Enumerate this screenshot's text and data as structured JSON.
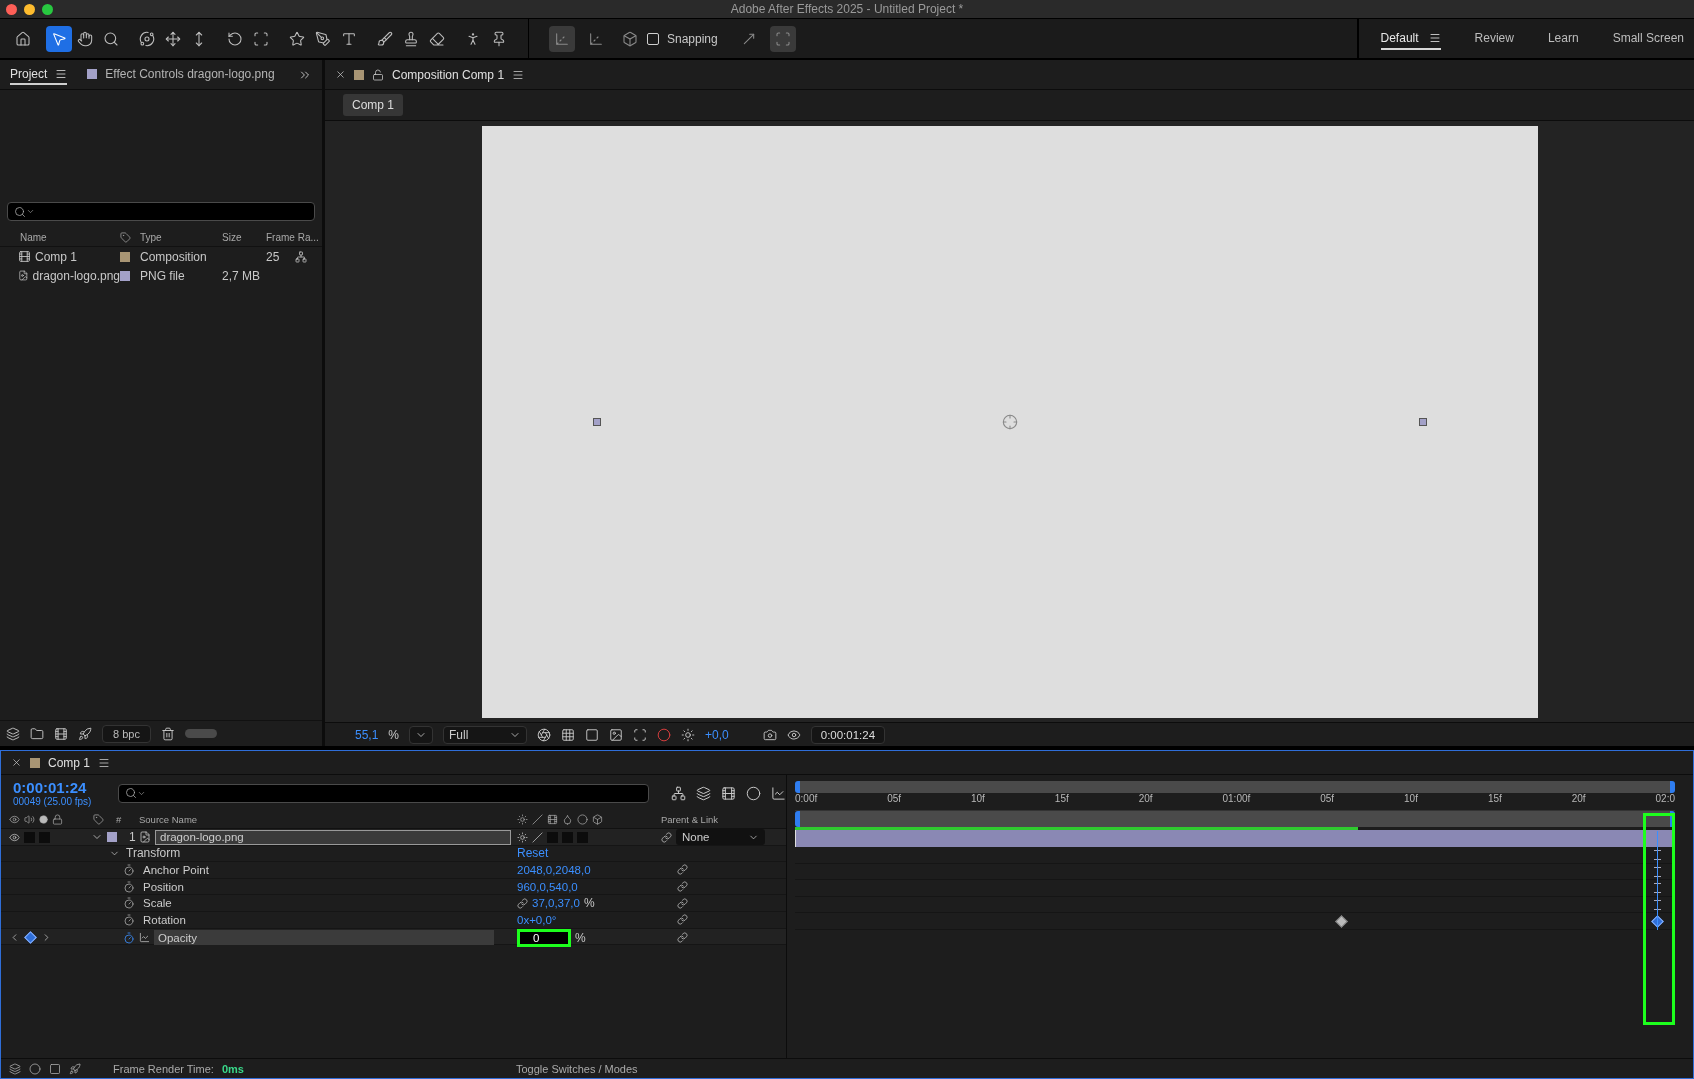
{
  "window": {
    "title": "Adobe After Effects 2025 - Untitled Project *"
  },
  "toolbar": {
    "tools": [
      {
        "selected": false
      },
      {
        "selected": true
      },
      {
        "selected": false
      },
      {
        "selected": false
      },
      {
        "selected": false
      },
      {
        "selected": false
      },
      {
        "selected": false
      },
      {
        "selected": false
      },
      {
        "selected": false
      },
      {
        "selected": false
      },
      {
        "selected": false
      },
      {
        "selected": false
      },
      {
        "selected": false
      },
      {
        "selected": false
      },
      {
        "selected": false
      },
      {
        "selected": false
      },
      {
        "selected": false
      }
    ],
    "snapping": {
      "label": "Snapping",
      "checked": false
    },
    "snap_options": [
      {
        "on": false
      },
      {
        "on": true
      }
    ],
    "workspaces": [
      {
        "label": "Default",
        "selected": true
      },
      {
        "label": "Review",
        "selected": false
      },
      {
        "label": "Learn",
        "selected": false
      },
      {
        "label": "Small Screen",
        "selected": false
      }
    ]
  },
  "project_panel": {
    "tabs": [
      {
        "label": "Project",
        "selected": true
      },
      {
        "label": "Effect Controls dragon-logo.png",
        "selected": false,
        "color": "#a3a1c8"
      }
    ],
    "columns": [
      "Name",
      "Type",
      "Size",
      "Frame Ra..."
    ],
    "rows": [
      {
        "name": "Comp 1",
        "kind": "composition",
        "color": "#a89574",
        "type": "Composition",
        "size": "",
        "frame_rate": "25"
      },
      {
        "name": "dragon-logo.png",
        "kind": "file",
        "color": "#a3a1c8",
        "type": "PNG file",
        "size": "2,7 MB",
        "frame_rate": ""
      }
    ],
    "bit_depth": "8 bpc"
  },
  "composition_panel": {
    "tab": "Composition Comp 1",
    "color": "#a89574",
    "breadcrumb": "Comp 1",
    "zoom": "55,1",
    "zoom_unit": "%",
    "resolution": "Full",
    "exposure": "+0,0",
    "timecode": "0:00:01:24"
  },
  "timeline": {
    "tab": "Comp 1",
    "color": "#a89574",
    "timecode": "0:00:01:24",
    "frame_info": "00049 (25.00 fps)",
    "columns": {
      "number": "#",
      "source": "Source Name",
      "parent": "Parent & Link"
    },
    "layer": {
      "index": "1",
      "name": "dragon-logo.png",
      "color": "#a3a1c8",
      "parent": "None",
      "expanded": true
    },
    "group": {
      "name": "Transform",
      "action": "Reset",
      "expanded": true
    },
    "properties": [
      {
        "name": "Anchor Point",
        "kind": "value",
        "value": "2048,0,2048,0",
        "selected": false
      },
      {
        "name": "Position",
        "kind": "value",
        "value": "960,0,540,0",
        "selected": false
      },
      {
        "name": "Scale",
        "kind": "linked",
        "value": "37,0,37,0",
        "unit": "%",
        "selected": false
      },
      {
        "name": "Rotation",
        "kind": "value",
        "value": "0x+0,0°",
        "selected": false
      },
      {
        "name": "Opacity",
        "kind": "field",
        "value": "0",
        "unit": "%",
        "selected": true
      }
    ],
    "ruler": [
      "0:00f",
      "05f",
      "10f",
      "15f",
      "20f",
      "01:00f",
      "05f",
      "10f",
      "15f",
      "20f",
      "02:0"
    ],
    "cache": {
      "level": 0.64
    },
    "playhead": {
      "level": 0.98
    },
    "keyframes": [
      {
        "level": 0.62,
        "selected": false
      },
      {
        "level": 0.98,
        "selected": true
      }
    ],
    "status": {
      "label": "Frame Render Time:",
      "value": "0ms",
      "toggle": "Toggle Switches / Modes"
    }
  }
}
